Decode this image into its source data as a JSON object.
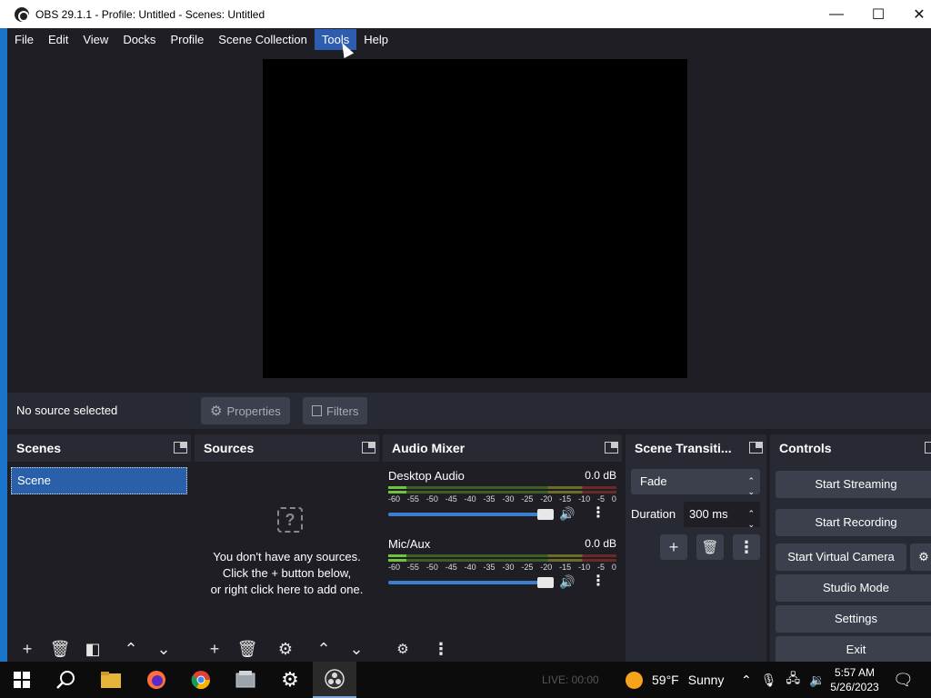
{
  "window": {
    "title": "OBS 29.1.1 - Profile: Untitled - Scenes: Untitled",
    "minimize": "—",
    "maximize": "☐",
    "close": "✕"
  },
  "menu": {
    "items": [
      "File",
      "Edit",
      "View",
      "Docks",
      "Profile",
      "Scene Collection",
      "Tools",
      "Help"
    ],
    "active": "Tools"
  },
  "context": {
    "no_source": "No source selected",
    "properties": "Properties",
    "filters": "Filters"
  },
  "scenes": {
    "title": "Scenes",
    "items": [
      "Scene"
    ]
  },
  "sources": {
    "title": "Sources",
    "empty_line1": "You don't have any sources.",
    "empty_line2": "Click the + button below,",
    "empty_line3": "or right click here to add one."
  },
  "mixer": {
    "title": "Audio Mixer",
    "channels": [
      {
        "name": "Desktop Audio",
        "db": "0.0 dB",
        "volume": 1.0
      },
      {
        "name": "Mic/Aux",
        "db": "0.0 dB",
        "volume": 1.0
      }
    ],
    "ticks": [
      "-60",
      "-55",
      "-50",
      "-45",
      "-40",
      "-35",
      "-30",
      "-25",
      "-20",
      "-15",
      "-10",
      "-5",
      "0"
    ]
  },
  "transitions": {
    "title": "Scene Transiti...",
    "selected": "Fade",
    "duration_label": "Duration",
    "duration_value": "300 ms"
  },
  "controls": {
    "title": "Controls",
    "start_streaming": "Start Streaming",
    "start_recording": "Start Recording",
    "start_virtual_camera": "Start Virtual Camera",
    "studio_mode": "Studio Mode",
    "settings": "Settings",
    "exit": "Exit"
  },
  "taskbar": {
    "status_text": "LIVE: 00:00",
    "weather_temp": "59°F",
    "weather_desc": "Sunny",
    "time": "5:57 AM",
    "date": "5/26/2023"
  },
  "colors": {
    "accent": "#2a5faa",
    "background": "#1e1e24",
    "panel": "#272a33",
    "button": "#3c404d",
    "volume": "#3b7fd1"
  }
}
